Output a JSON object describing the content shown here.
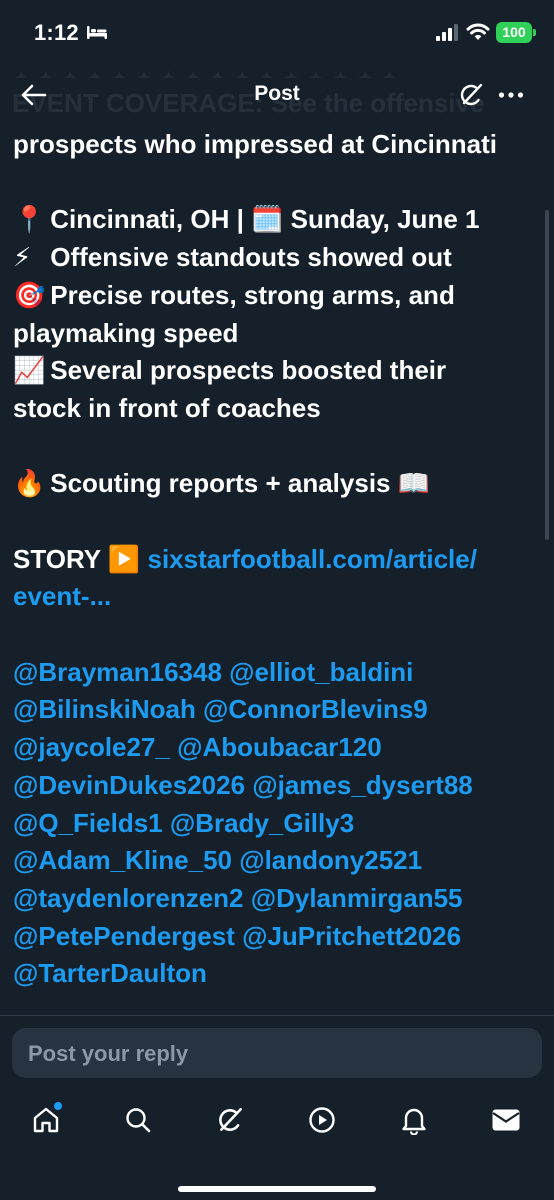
{
  "status_bar": {
    "time": "1:12",
    "battery": "100",
    "battery_color": "#30d158"
  },
  "header": {
    "ghost_text": "EVENT COVERAGE: See the offensive",
    "ghost_top_text": "✦ ✦ ✦ ✦ ✦ ✦ ✦ ✦ ✦ ✦ ✦ ✦ ✦ ✦ ✦ ✦",
    "title": "Post",
    "back_icon": "arrow-left-icon",
    "grok_icon": "grok-icon",
    "more_icon": "more-icon"
  },
  "post": {
    "line1": "prospects who impressed at Cincinnati",
    "line2_emoji": "📍",
    "line2_text": "Cincinnati, OH | ",
    "line2_emoji2": "🗓️",
    "line2_text2": " Sunday, June 1",
    "line3_emoji": "⚡",
    "line3_text": "Offensive standouts showed out",
    "line4_emoji": "🎯",
    "line4_text": "Precise routes, strong arms, and",
    "line5": "playmaking speed",
    "line6_emoji": "📈",
    "line6_text": "Several prospects boosted their",
    "line7": "stock in front of coaches",
    "line8_emoji": "🔥",
    "line8_text": "Scouting reports + analysis ",
    "line8_emoji2": "📖",
    "story_label": "STORY ",
    "story_emoji": "▶️",
    "story_link_1": "sixstarfootball.com/article/",
    "story_link_2": "event-...",
    "mentions": [
      "@Brayman16348 @elliot_baldini",
      "@BilinskiNoah @ConnorBlevins9",
      "@jaycole27_ @Aboubacar120",
      "@DevinDukes2026 @james_dysert88",
      "@Q_Fields1 @Brady_Gilly3",
      "@Adam_Kline_50 @landony2521",
      "@taydenlorenzen2 @Dylanmirgan55",
      "@PetePendergest @JuPritchett2026",
      "@TarterDaulton"
    ]
  },
  "reply": {
    "placeholder": "Post your reply"
  },
  "tab_bar": {
    "items": [
      "home-icon",
      "search-icon",
      "grok-icon",
      "video-icon",
      "notifications-icon",
      "messages-icon"
    ]
  },
  "colors": {
    "background": "#15202b",
    "link": "#1d9bf0",
    "muted": "#8b98a5"
  }
}
